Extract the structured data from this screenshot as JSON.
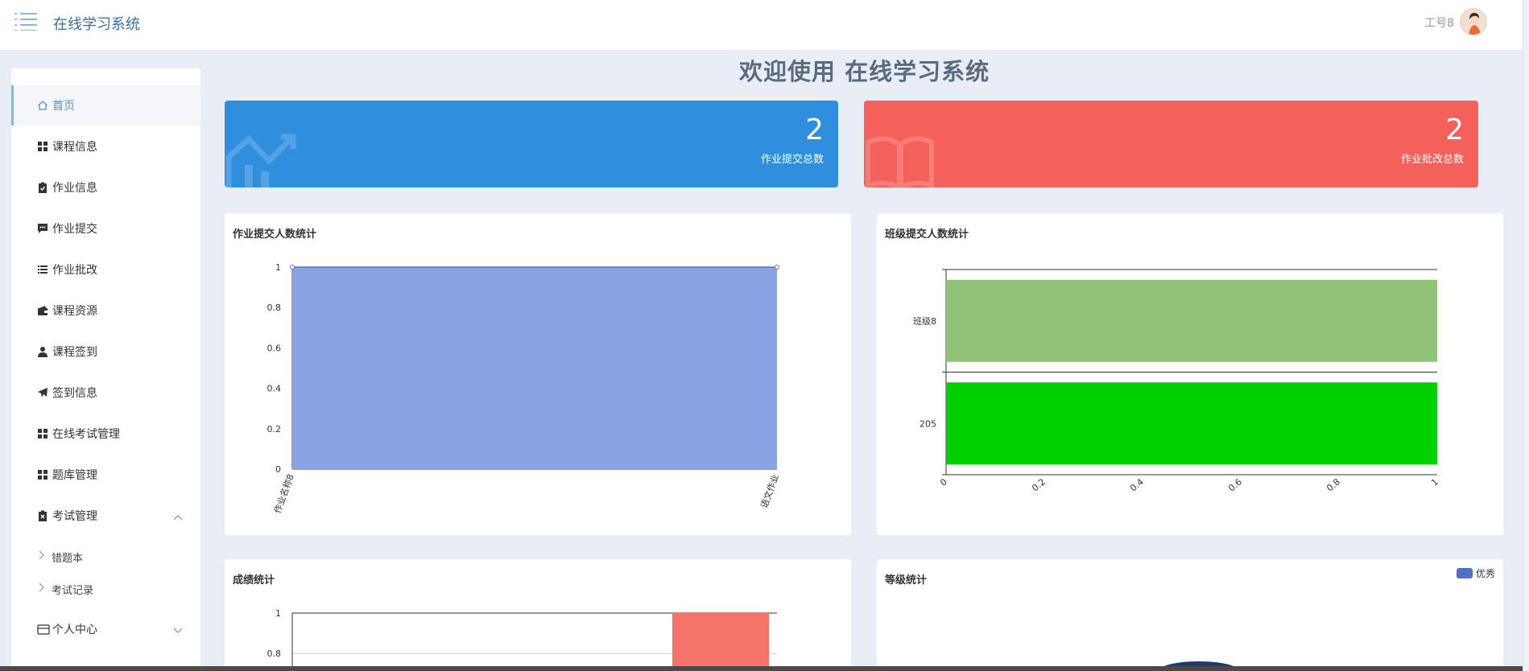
{
  "header": {
    "app_title": "在线学习系统",
    "user_name": "工号8"
  },
  "sidebar": {
    "items": [
      {
        "label": "首页",
        "icon": "home-icon"
      },
      {
        "label": "课程信息",
        "icon": "grid-icon"
      },
      {
        "label": "作业信息",
        "icon": "clipboard-check-icon"
      },
      {
        "label": "作业提交",
        "icon": "chat-icon"
      },
      {
        "label": "作业批改",
        "icon": "list-icon"
      },
      {
        "label": "课程资源",
        "icon": "wallet-icon"
      },
      {
        "label": "课程签到",
        "icon": "user-icon"
      },
      {
        "label": "签到信息",
        "icon": "paper-plane-icon"
      },
      {
        "label": "在线考试管理",
        "icon": "grid-icon"
      },
      {
        "label": "题库管理",
        "icon": "grid-icon"
      },
      {
        "label": "考试管理",
        "icon": "clipboard-x-icon"
      }
    ],
    "exam_sub": [
      {
        "label": "错题本"
      },
      {
        "label": "考试记录"
      }
    ],
    "personal": {
      "label": "个人中心",
      "icon": "id-card-icon"
    }
  },
  "main": {
    "welcome": "欢迎使用 在线学习系统",
    "cards": [
      {
        "value": "2",
        "label": "作业提交总数",
        "color": "#2f8fde",
        "icon": "chart-icon"
      },
      {
        "value": "2",
        "label": "作业批改总数",
        "color": "#f4605a",
        "icon": "book-icon"
      }
    ],
    "panels": {
      "p1_title": "作业提交人数统计",
      "p2_title": "班级提交人数统计",
      "p3_title": "成绩统计",
      "p4_title": "等级统计",
      "p4_legend": "优秀"
    }
  },
  "chart_data": [
    {
      "type": "area",
      "title": "作业提交人数统计",
      "categories": [
        "作业名称8",
        "语文作业"
      ],
      "values": [
        1,
        1
      ],
      "ylim": [
        0,
        1
      ],
      "yticks": [
        0,
        0.2,
        0.4,
        0.6,
        0.8,
        1
      ],
      "color": "#8aa3e4"
    },
    {
      "type": "bar",
      "orientation": "horizontal",
      "title": "班级提交人数统计",
      "categories": [
        "205",
        "班级8"
      ],
      "values": [
        1,
        1
      ],
      "bar_colors": [
        "#00d000",
        "#90c277"
      ],
      "xlim": [
        0,
        1
      ],
      "xticks": [
        0,
        0.2,
        0.4,
        0.6,
        0.8,
        1
      ]
    },
    {
      "type": "bar",
      "title": "成绩统计",
      "yticks_visible": [
        0.8,
        1
      ],
      "color": "#f6736a"
    },
    {
      "type": "pie",
      "title": "等级统计",
      "legend": [
        "优秀"
      ],
      "color": "#5470c6"
    }
  ]
}
